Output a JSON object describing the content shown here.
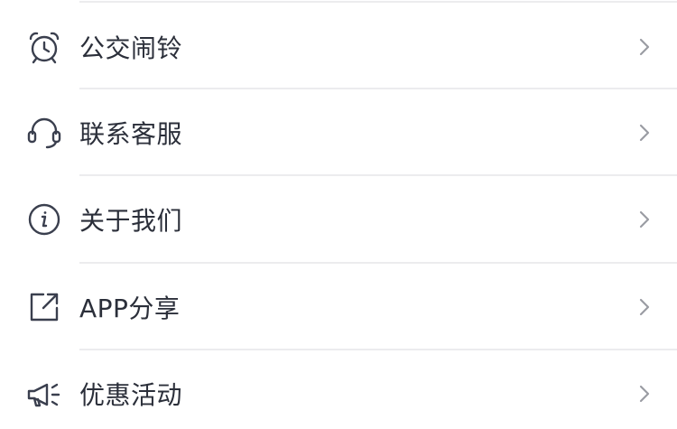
{
  "menu": {
    "items": [
      {
        "label": "公交闹铃",
        "icon": "alarm-clock-icon"
      },
      {
        "label": "联系客服",
        "icon": "headset-icon"
      },
      {
        "label": "关于我们",
        "icon": "info-icon"
      },
      {
        "label": "APP分享",
        "icon": "share-icon"
      },
      {
        "label": "优惠活动",
        "icon": "megaphone-icon"
      }
    ]
  },
  "colors": {
    "text": "#2b2f3a",
    "icon": "#3a3f4e",
    "chevron": "#9a9ca3",
    "divider": "#ececee",
    "background": "#ffffff"
  }
}
